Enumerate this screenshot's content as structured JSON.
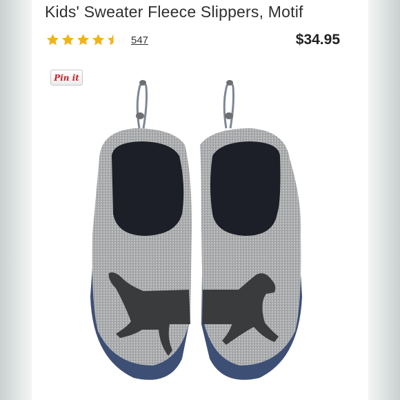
{
  "product": {
    "title": "Kids' Sweater Fleece Slippers, Motif",
    "rating": 4.5,
    "review_count": "547",
    "price": "$34.95"
  },
  "share": {
    "pin_label": "Pin it"
  },
  "colors": {
    "star": "#f2b318",
    "fleece": "#a7a9ab",
    "sole": "#3d4f74",
    "lining": "#1c1f27",
    "dog": "#3a3b3d",
    "pin_red": "#cb2027"
  },
  "icons": [
    "star-icon",
    "star-half-icon",
    "pinterest-icon"
  ],
  "image": {
    "subject": ""
  }
}
